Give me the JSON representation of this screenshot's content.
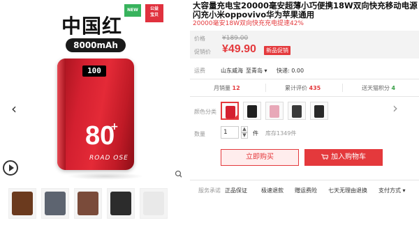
{
  "gallery": {
    "badge_new": "NEW",
    "badge_charity_line1": "公益",
    "badge_charity_line2": "宝贝",
    "brand_text": "中国红",
    "capacity_text": "8000mAh",
    "screen_text": "100",
    "watt_text": "80",
    "watt_plus": "+",
    "logo_text": "ROAD OSE",
    "prev_icon": "‹",
    "next_icon": "›",
    "thumb_colors": [
      "#6b3a1e",
      "#5d6470",
      "#7a4b3a",
      "#2c2c2c",
      "#e9e9e9"
    ],
    "accent": "#e4393c"
  },
  "product": {
    "title": "大容量充电宝20000毫安超薄小巧便携18W双向快充移动电源闪充小米oppovivo华为苹果通用",
    "subtitle": "20000毫安18W双向快充充电提速42%",
    "price_label": "价格",
    "original_price": "¥189.00",
    "promo_label": "促销价",
    "promo_price": "¥49.90",
    "promo_badge": "新品促销"
  },
  "shipping": {
    "label": "运费",
    "from": "山东威海",
    "to_word": "至",
    "destination": "青岛 ▾",
    "fee": "快递: 0.00"
  },
  "stats": {
    "monthly_label": "月销量",
    "monthly_value": "12",
    "reviews_label": "累计评价",
    "reviews_value": "435",
    "points_label": "送天猫积分",
    "points_value": "4"
  },
  "options": {
    "color_label": "颜色分类",
    "swatch_colors": [
      "#d42030",
      "#1f1f1f",
      "#e8a8b8",
      "#3a3a3a",
      "#2a2a2a"
    ],
    "qty_label": "数量",
    "qty_value": "1",
    "qty_unit": "件",
    "stock": "库存1349件"
  },
  "actions": {
    "buy_now": "立即购买",
    "add_cart": "加入购物车"
  },
  "service": {
    "label": "服务承诺",
    "items": [
      "正品保证",
      "极速退款",
      "赠运费险",
      "七天无理由退换"
    ],
    "payment": "支付方式 ▾"
  }
}
